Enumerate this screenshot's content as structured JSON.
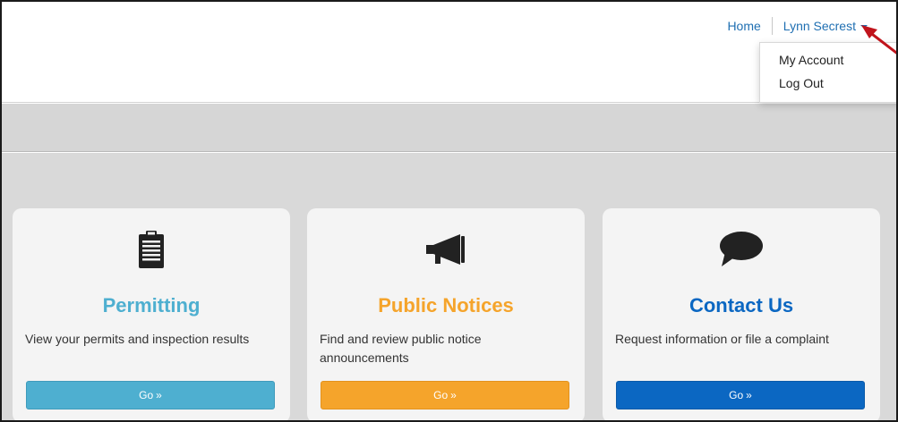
{
  "nav": {
    "home": "Home",
    "user": "Lynn Secrest",
    "dropdown": [
      "My Account",
      "Log Out"
    ]
  },
  "colors": {
    "link": "#1f6fb2",
    "permitting": "#4eafd0",
    "notices": "#f5a42b",
    "contact": "#0b67c2",
    "annotation_arrow": "#c0141c"
  },
  "cards": [
    {
      "title": "Permitting",
      "description": "View your permits and inspection results",
      "button": "Go",
      "button_suffix": "»",
      "icon": "clipboard-icon"
    },
    {
      "title": "Public Notices",
      "description": "Find and review public notice announcements",
      "button": "Go",
      "button_suffix": "»",
      "icon": "megaphone-icon"
    },
    {
      "title": "Contact Us",
      "description": "Request information or file a complaint",
      "button": "Go",
      "button_suffix": "»",
      "icon": "speech-bubble-icon"
    }
  ]
}
